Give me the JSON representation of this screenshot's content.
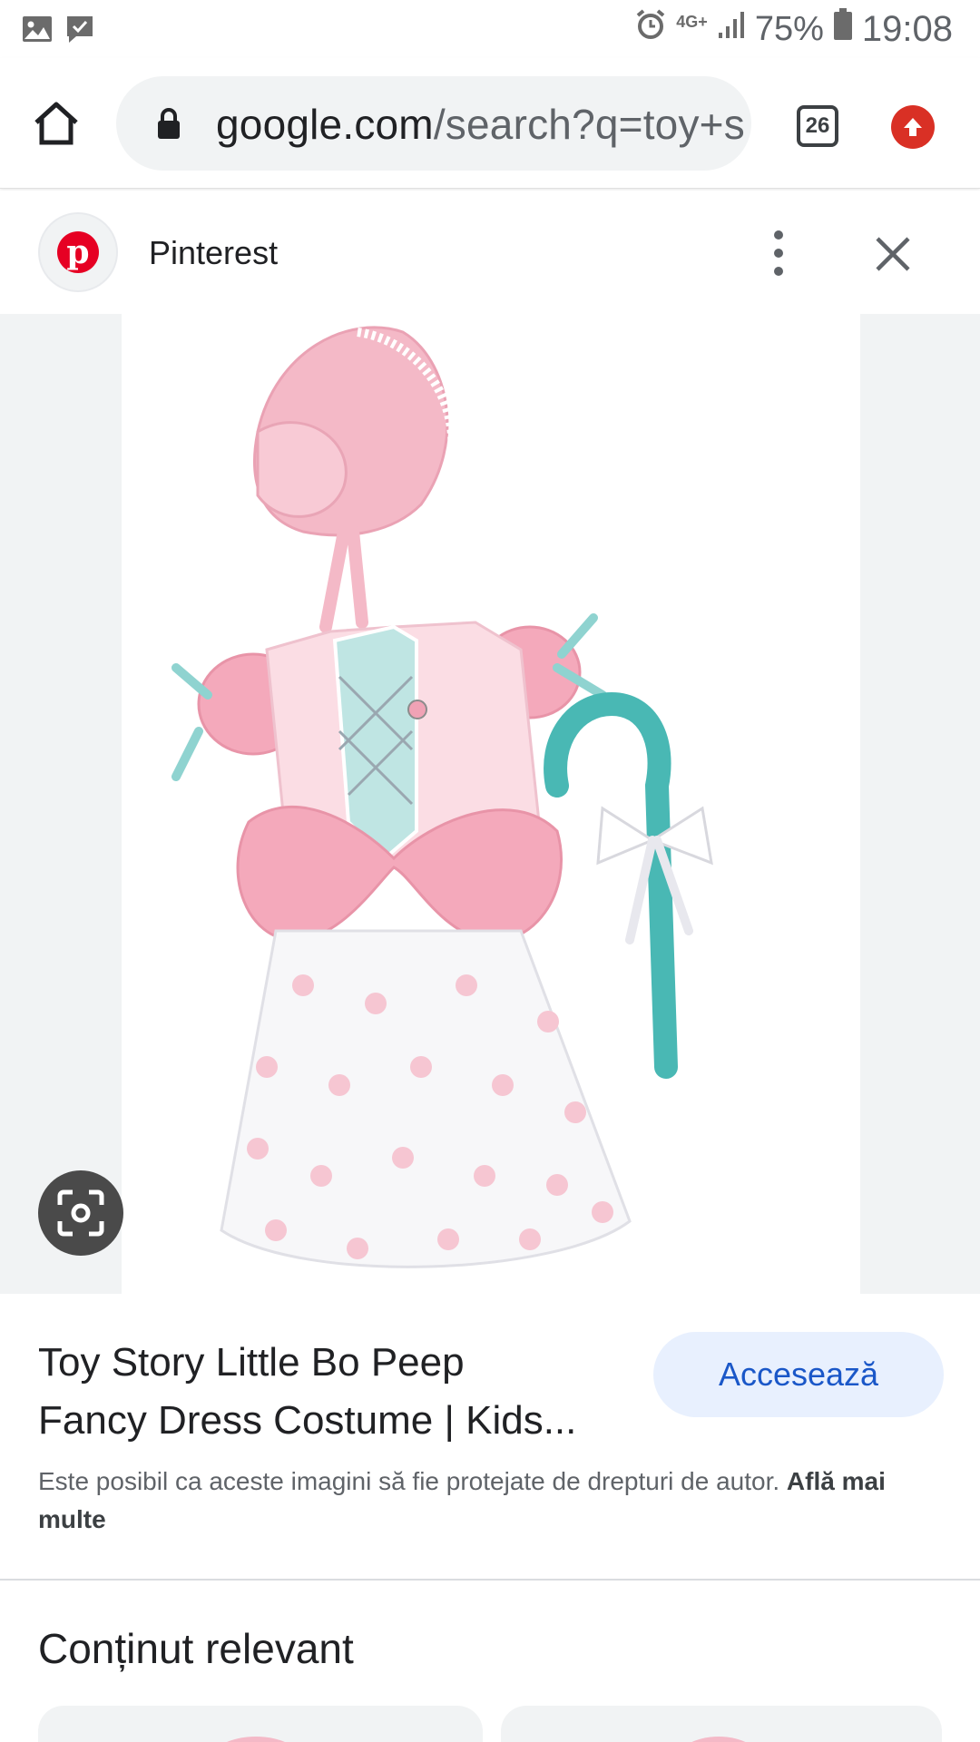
{
  "status_bar": {
    "network": "4G+",
    "battery": "75%",
    "time": "19:08"
  },
  "browser": {
    "url_domain": "google.com",
    "url_path": "/search?q=toy+s",
    "tab_count": "26"
  },
  "source": {
    "name": "Pinterest"
  },
  "result": {
    "title_line1": "Toy Story Little Bo Peep",
    "title_line2": "Fancy Dress Costume | Kids...",
    "visit_label": "Accesează",
    "copyright_text": "Este posibil ca aceste imagini să fie protejate de drepturi de autor. ",
    "learn_more": "Află mai multe"
  },
  "related": {
    "heading": "Conținut relevant"
  },
  "colors": {
    "accent_blue": "#1a57c8",
    "pinterest_red": "#e60023",
    "dress_pink": "#f5b5c4",
    "staff_teal": "#49b8b4"
  }
}
